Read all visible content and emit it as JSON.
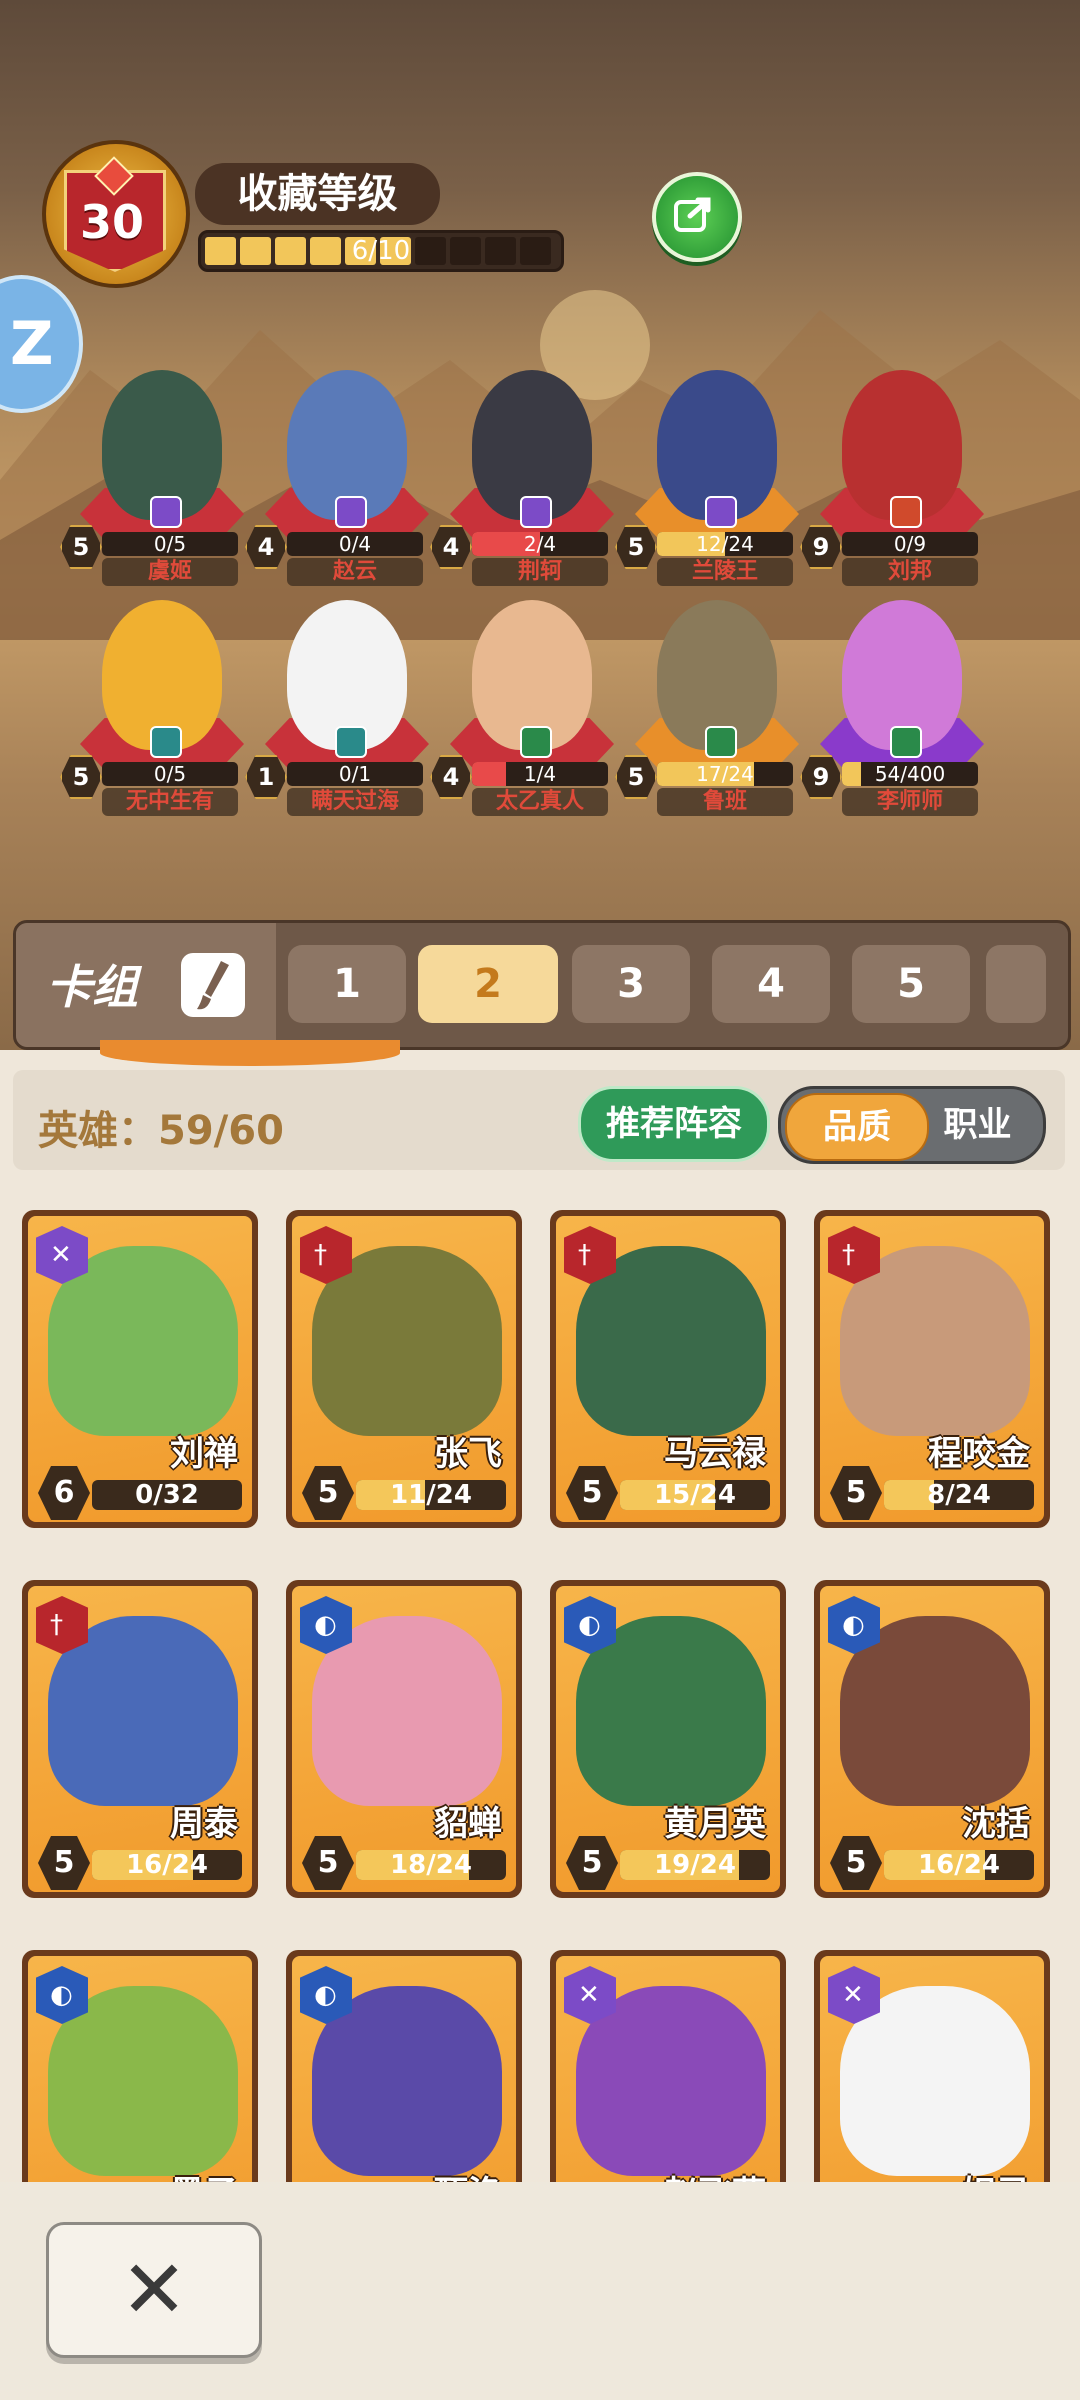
{
  "collection": {
    "level": "30",
    "title": "收藏等级",
    "progress_text": "6/10",
    "progress": 0.6
  },
  "top_heroes": [
    {
      "name": "虞姬",
      "level": "5",
      "progress": "0/5",
      "fill": 0.0,
      "plat": "#c8323a",
      "cls": "#7c4bc7",
      "cls_icon": "swords-icon",
      "fig": "#3a5a4a"
    },
    {
      "name": "赵云",
      "level": "4",
      "progress": "0/4",
      "fill": 0.0,
      "plat": "#c8323a",
      "cls": "#7c4bc7",
      "cls_icon": "swords-icon",
      "fig": "#5a7ab8"
    },
    {
      "name": "荆轲",
      "level": "4",
      "progress": "2/4",
      "fill": 0.5,
      "plat": "#c8323a",
      "cls": "#7c4bc7",
      "cls_icon": "swords-icon",
      "fig": "#3a3a44"
    },
    {
      "name": "兰陵王",
      "level": "5",
      "progress": "12/24",
      "fill": 0.5,
      "plat": "#e88f2a",
      "cls": "#7c4bc7",
      "cls_icon": "swords-icon",
      "fig": "#3a4a8a"
    },
    {
      "name": "刘邦",
      "level": "9",
      "progress": "0/9",
      "fill": 0.0,
      "plat": "#c8323a",
      "cls": "#d04a2c",
      "cls_icon": "hat-icon",
      "fig": "#b83030"
    },
    {
      "name": "无中生有",
      "level": "5",
      "progress": "0/5",
      "fill": 0.0,
      "plat": "#c8323a",
      "cls": "#2a8a8a",
      "cls_icon": "potion-icon",
      "fig": "#f0b030"
    },
    {
      "name": "瞒天过海",
      "level": "1",
      "progress": "0/1",
      "fill": 0.0,
      "plat": "#c8323a",
      "cls": "#2a8a8a",
      "cls_icon": "potion-icon",
      "fig": "#f3f3f3"
    },
    {
      "name": "太乙真人",
      "level": "4",
      "progress": "1/4",
      "fill": 0.25,
      "plat": "#c8323a",
      "cls": "#2a8a4a",
      "cls_icon": "shield-plus-icon",
      "fig": "#e8b890"
    },
    {
      "name": "鲁班",
      "level": "5",
      "progress": "17/24",
      "fill": 0.71,
      "plat": "#e88f2a",
      "cls": "#2a8a4a",
      "cls_icon": "shield-plus-icon",
      "fig": "#8a7a5a"
    },
    {
      "name": "李师师",
      "level": "9",
      "progress": "54/400",
      "fill": 0.14,
      "plat": "#8a3acb",
      "cls": "#2a8a4a",
      "cls_icon": "shield-plus-icon",
      "fig": "#d07ad8"
    }
  ],
  "deck": {
    "label": "卡组",
    "tabs": [
      "1",
      "2",
      "3",
      "4",
      "5"
    ],
    "active": 1
  },
  "heroes_label": "英雄：59/60",
  "recommend_label": "推荐阵容",
  "toggle": {
    "quality": "品质",
    "profession": "职业"
  },
  "cards": [
    {
      "name": "刘禅",
      "level": "6",
      "progress": "0/32",
      "fill": 0.0,
      "cls": "#7c4bc7",
      "cls_icon": "swords-icon",
      "char": "#7ab85a"
    },
    {
      "name": "张飞",
      "level": "5",
      "progress": "11/24",
      "fill": 0.46,
      "cls": "#b8262c",
      "cls_icon": "sword-icon",
      "char": "#7a7a3a"
    },
    {
      "name": "马云禄",
      "level": "5",
      "progress": "15/24",
      "fill": 0.63,
      "cls": "#b8262c",
      "cls_icon": "sword-icon",
      "char": "#3a6a4a"
    },
    {
      "name": "程咬金",
      "level": "5",
      "progress": "8/24",
      "fill": 0.33,
      "cls": "#b8262c",
      "cls_icon": "sword-icon",
      "char": "#c89a7a"
    },
    {
      "name": "周泰",
      "level": "5",
      "progress": "16/24",
      "fill": 0.67,
      "cls": "#b8262c",
      "cls_icon": "sword-icon",
      "char": "#4a6ab8"
    },
    {
      "name": "貂蝉",
      "level": "5",
      "progress": "18/24",
      "fill": 0.75,
      "cls": "#2a5ab8",
      "cls_icon": "helmet-icon",
      "char": "#e89ab0"
    },
    {
      "name": "黄月英",
      "level": "5",
      "progress": "19/24",
      "fill": 0.79,
      "cls": "#2a5ab8",
      "cls_icon": "helmet-icon",
      "char": "#3a7a4a"
    },
    {
      "name": "沈括",
      "level": "5",
      "progress": "16/24",
      "fill": 0.67,
      "cls": "#2a5ab8",
      "cls_icon": "helmet-icon",
      "char": "#7a4a3a"
    },
    {
      "name": "墨子",
      "level": "",
      "progress": "",
      "fill": 0,
      "cls": "#2a5ab8",
      "cls_icon": "helmet-icon",
      "char": "#8ab84a"
    },
    {
      "name": "甄洛",
      "level": "",
      "progress": "",
      "fill": 0,
      "cls": "#2a5ab8",
      "cls_icon": "helmet-icon",
      "char": "#5a4aa8"
    },
    {
      "name": "赵飞燕",
      "level": "",
      "progress": "",
      "fill": 0,
      "cls": "#7c4bc7",
      "cls_icon": "swords-icon",
      "char": "#8a4ab8"
    },
    {
      "name": "妲己",
      "level": "",
      "progress": "",
      "fill": 0,
      "cls": "#7c4bc7",
      "cls_icon": "swords-icon",
      "char": "#f4f4f4"
    }
  ]
}
